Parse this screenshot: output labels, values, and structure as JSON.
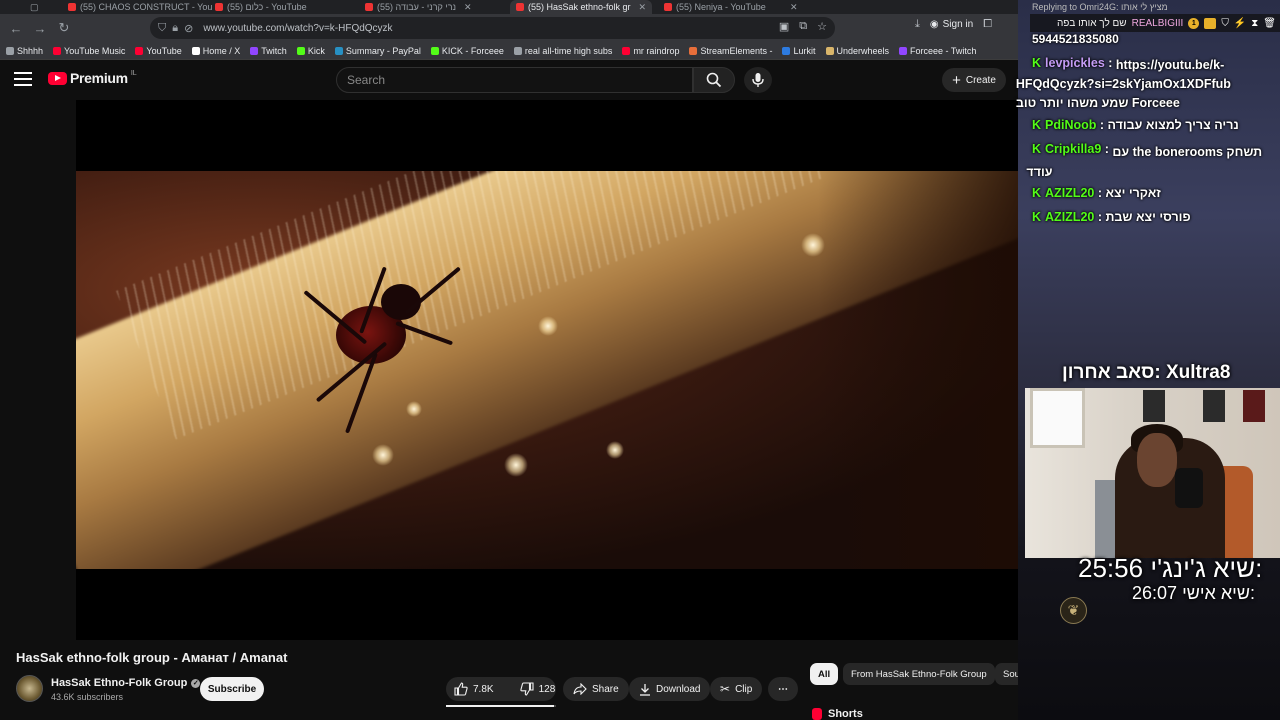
{
  "browser": {
    "tabs": [
      {
        "label": "(55) CHAOS CONSTRUCT - You",
        "active": false
      },
      {
        "label": "(55) כלום - YouTube",
        "active": false
      },
      {
        "label": "(55) נרי קרני - עבודה",
        "active": false
      },
      {
        "label": "(55) HasSak ethno-folk gr",
        "active": true
      },
      {
        "label": "(55) Neniya - YouTube",
        "active": false
      }
    ],
    "url": "www.youtube.com/watch?v=k-HFQdQcyzk",
    "sign_in": "Sign in",
    "bookmarks": [
      {
        "label": "Shhhh",
        "icon": "folder-icon",
        "color": "#9aa0a6"
      },
      {
        "label": "YouTube Music",
        "icon": "youtube-music-icon",
        "color": "#ff0033"
      },
      {
        "label": "YouTube",
        "icon": "youtube-icon",
        "color": "#ff0033"
      },
      {
        "label": "Home / X",
        "icon": "x-icon",
        "color": "#ffffff"
      },
      {
        "label": "Twitch",
        "icon": "twitch-icon",
        "color": "#9146ff"
      },
      {
        "label": "Kick",
        "icon": "kick-icon",
        "color": "#53fc18"
      },
      {
        "label": "Summary - PayPal",
        "icon": "paypal-icon",
        "color": "#2790c3"
      },
      {
        "label": "KICK - Forceee",
        "icon": "kick-icon",
        "color": "#53fc18"
      },
      {
        "label": "real all-time high subs",
        "icon": "pen-icon",
        "color": "#9aa0a6"
      },
      {
        "label": "mr raindrop",
        "icon": "youtube-icon",
        "color": "#ff0033"
      },
      {
        "label": "StreamElements -",
        "icon": "streamelements-icon",
        "color": "#e86e3a"
      },
      {
        "label": "Lurkit",
        "icon": "lurkit-icon",
        "color": "#2d7be0"
      },
      {
        "label": "Underwheels",
        "icon": "underwheels-icon",
        "color": "#d9b56a"
      },
      {
        "label": "Forceee - Twitch",
        "icon": "twitch-icon",
        "color": "#9146ff"
      }
    ]
  },
  "youtube": {
    "logo_text": "Premium",
    "country_code": "IL",
    "search_placeholder": "Search",
    "create_label": "Create",
    "video_title": "HasSak ethno-folk group - Аманат / Amanat",
    "channel_name": "HasSak Ethno-Folk Group",
    "subscribers": "43.6K subscribers",
    "subscribe_label": "Subscribe",
    "likes": "7.8K",
    "dislikes": "128",
    "like_ratio": 0.98,
    "share_label": "Share",
    "download_label": "Download",
    "clip_label": "Clip",
    "chips": [
      "All",
      "From HasSak Ethno-Folk Group",
      "Soundtra"
    ],
    "shorts_label": "Shorts"
  },
  "stream": {
    "reply_to": "Replying to Omri24G: מציץ לי אותו",
    "top_message": {
      "user": "REALBIGIII",
      "text": "שם לך אותו בפה"
    },
    "chat": [
      {
        "user": "",
        "text": "5944521835080"
      },
      {
        "user": "levpickles",
        "text": "https://youtu.be/k-HFQdQcyzk?si=2skYjamOx1XDFfub שמע משהו יותר טוב Forceee"
      },
      {
        "user": "PdiNoob",
        "text": "נריה צריך למצוא עבודה"
      },
      {
        "user": "Cripkilla9",
        "text": "עם the bonerooms תשחק עודד"
      },
      {
        "user": "AZIZL20",
        "text": "זאקרי יצא"
      },
      {
        "user": "AZIZL20",
        "text": "פורסי יצא שבת"
      }
    ],
    "last_sub_label": "סאב אחרון:",
    "last_sub_name": "Xultra8",
    "timer1_label": "שיא ג'ינג'י:",
    "timer1_value": "25:56",
    "timer2_label": "שיא אישי:",
    "timer2_value": "26:07"
  },
  "colors": {
    "yt_red": "#ff0033",
    "kick_green": "#53fc18",
    "background": "#0f0f0f"
  }
}
